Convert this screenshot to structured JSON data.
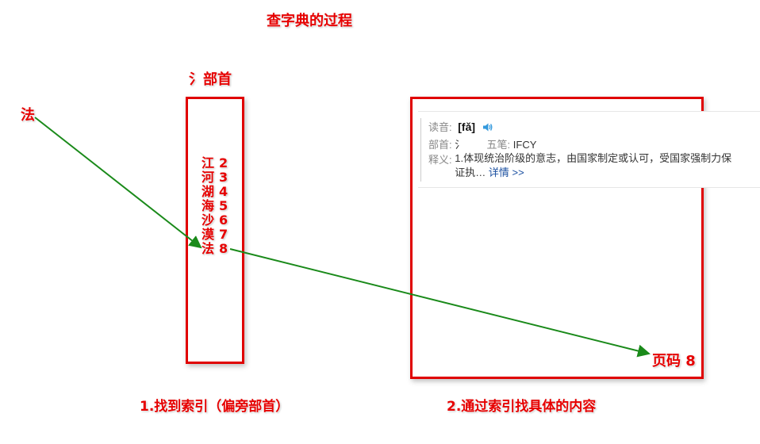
{
  "title": "查字典的过程",
  "radical_label": "氵部首",
  "source_char": "法",
  "index_entries": [
    {
      "char": "江",
      "page": "2"
    },
    {
      "char": "河",
      "page": "3"
    },
    {
      "char": "湖",
      "page": "4"
    },
    {
      "char": "海",
      "page": "5"
    },
    {
      "char": "沙",
      "page": "6"
    },
    {
      "char": "漠",
      "page": "7"
    },
    {
      "char": "法",
      "page": "8"
    }
  ],
  "dict_card": {
    "reading_label": "读音:",
    "pinyin": "[fǎ]",
    "radical_label": "部首:",
    "radical_value": "氵",
    "wubi_label": "五笔:",
    "wubi_value": "IFCY",
    "definition_label": "释义:",
    "definition_text": "1.体现统治阶级的意志，由国家制定或认可，受国家强制力保证执…",
    "more_link": "详情 >>"
  },
  "page_label": "页码 8",
  "caption_left": "1.找到索引（偏旁部首）",
  "caption_right": "2.通过索引找具体的内容",
  "colors": {
    "red": "#e60000",
    "arrow": "#1a8a1a",
    "link": "#1a4fa0",
    "speaker": "#3399dd"
  }
}
